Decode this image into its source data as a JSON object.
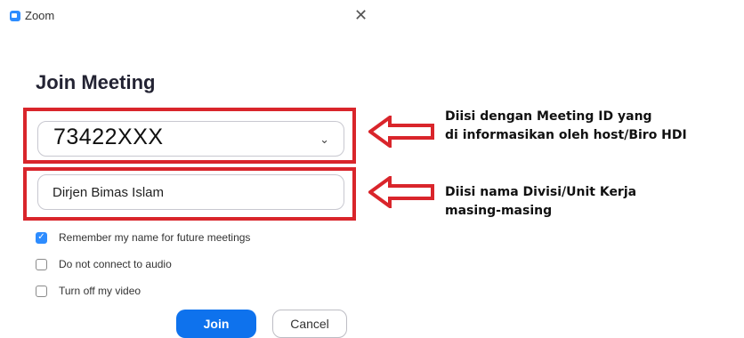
{
  "window": {
    "title": "Zoom",
    "brand_color": "#2d8cff"
  },
  "dialog": {
    "heading": "Join Meeting",
    "meeting_id": {
      "value": "73422XXX",
      "dropdown_icon": "chevron-down-icon"
    },
    "name_field": {
      "value": "Dirjen Bimas Islam"
    },
    "options": [
      {
        "label": "Remember my name for future meetings",
        "checked": true
      },
      {
        "label": "Do not connect to audio",
        "checked": false
      },
      {
        "label": "Turn off my video",
        "checked": false
      }
    ],
    "buttons": {
      "join": "Join",
      "cancel": "Cancel"
    },
    "join_color": "#0e72ed"
  },
  "annotations": {
    "highlight_color": "#d9252b",
    "note1": {
      "line1": "Diisi dengan Meeting ID yang",
      "line2": "di informasikan oleh host/Biro HDI"
    },
    "note2": {
      "line1": "Diisi nama Divisi/Unit Kerja",
      "line2": "masing-masing"
    }
  }
}
